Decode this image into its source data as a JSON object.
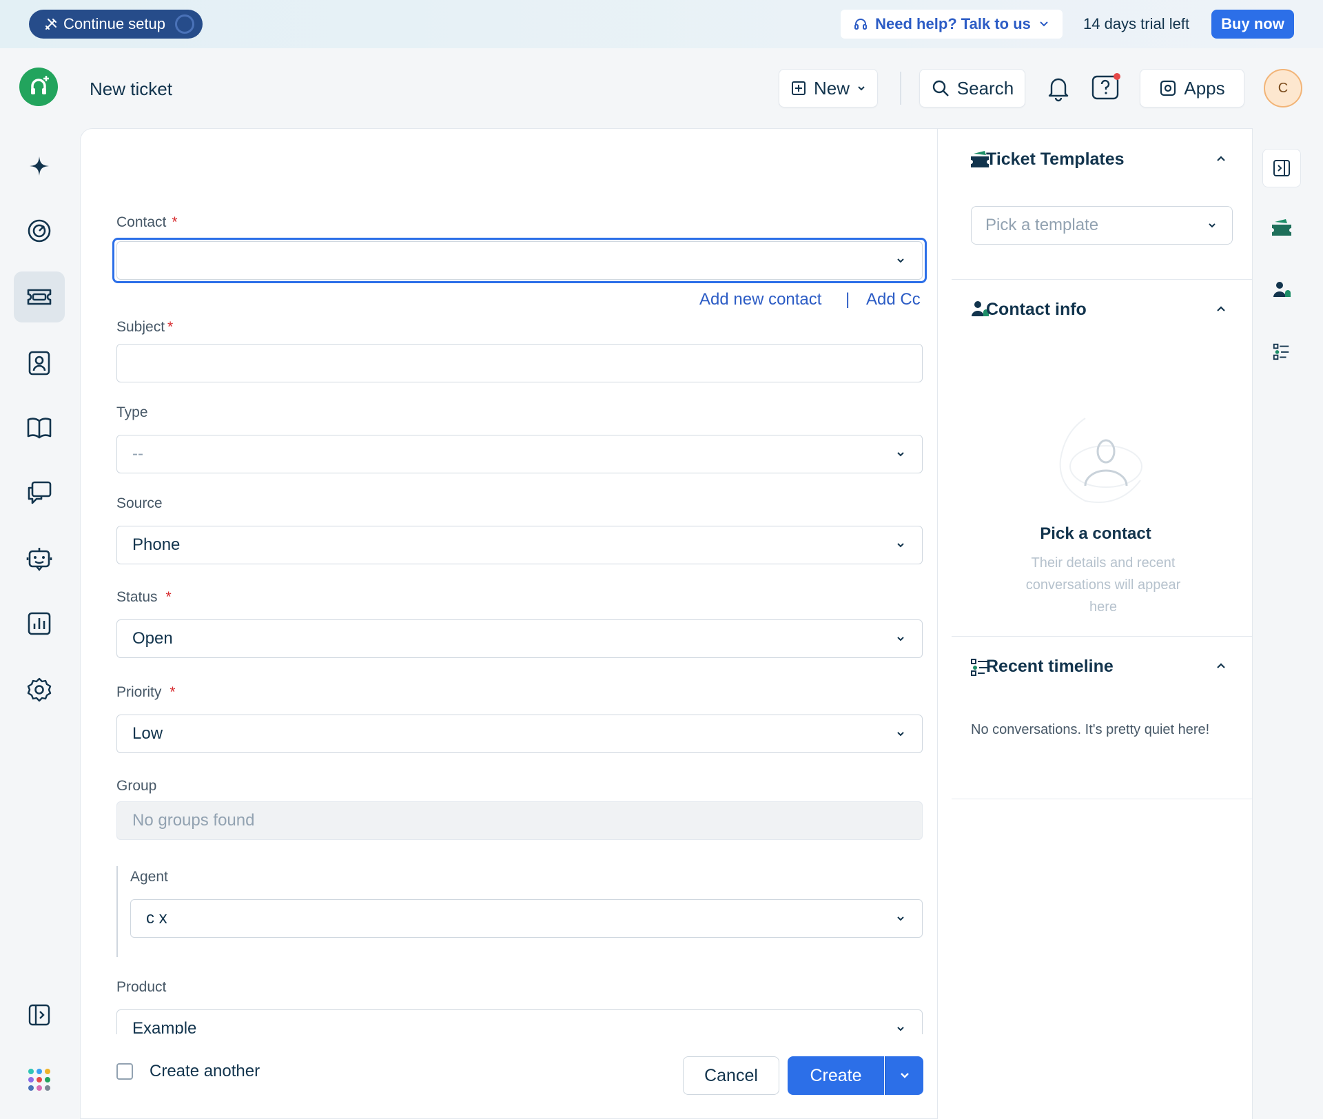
{
  "banner": {
    "continue_setup": "Continue setup",
    "help": "Need help? Talk to us",
    "trial": "14 days trial left",
    "buy_now": "Buy now"
  },
  "header": {
    "title": "New ticket",
    "new_label": "New",
    "search_label": "Search",
    "apps_label": "Apps",
    "avatar_initial": "C"
  },
  "sidebar": {
    "items": [
      {
        "name": "freddy-ai",
        "icon": "sparkle-icon",
        "active": false
      },
      {
        "name": "dashboard",
        "icon": "dashboard-icon",
        "active": false
      },
      {
        "name": "tickets",
        "icon": "ticket-icon",
        "active": true
      },
      {
        "name": "contacts",
        "icon": "contact-icon",
        "active": false
      },
      {
        "name": "solutions",
        "icon": "book-icon",
        "active": false
      },
      {
        "name": "discussions",
        "icon": "chat-icon",
        "active": false
      },
      {
        "name": "bot",
        "icon": "bot-icon",
        "active": false
      },
      {
        "name": "reports",
        "icon": "reports-icon",
        "active": false
      },
      {
        "name": "admin",
        "icon": "settings-icon",
        "active": false
      }
    ]
  },
  "form": {
    "contact": {
      "label": "Contact",
      "value": ""
    },
    "add_new_contact": "Add new contact",
    "link_separator": "|",
    "add_cc": "Add Cc",
    "subject": {
      "label": "Subject",
      "value": ""
    },
    "type": {
      "label": "Type",
      "value": "--"
    },
    "source": {
      "label": "Source",
      "value": "Phone"
    },
    "status": {
      "label": "Status",
      "value": "Open"
    },
    "priority": {
      "label": "Priority",
      "value": "Low"
    },
    "group": {
      "label": "Group",
      "value": "No groups found"
    },
    "agent": {
      "label": "Agent",
      "value": "c x"
    },
    "product": {
      "label": "Product",
      "value": "Example"
    },
    "required_mark": "*",
    "create_another": "Create another",
    "cancel": "Cancel",
    "create": "Create"
  },
  "right_panel": {
    "templates": {
      "title": "Ticket Templates",
      "placeholder": "Pick a template"
    },
    "contact_info": {
      "title": "Contact info",
      "empty_title": "Pick a contact",
      "empty_sub": "Their details and recent conversations will appear here"
    },
    "timeline": {
      "title": "Recent timeline",
      "empty": "No conversations. It's pretty quiet here!"
    }
  },
  "colors": {
    "primary": "#2c6fe8",
    "brand_green": "#22a45d",
    "required": "#d72d30",
    "link": "#2c5cc5"
  }
}
